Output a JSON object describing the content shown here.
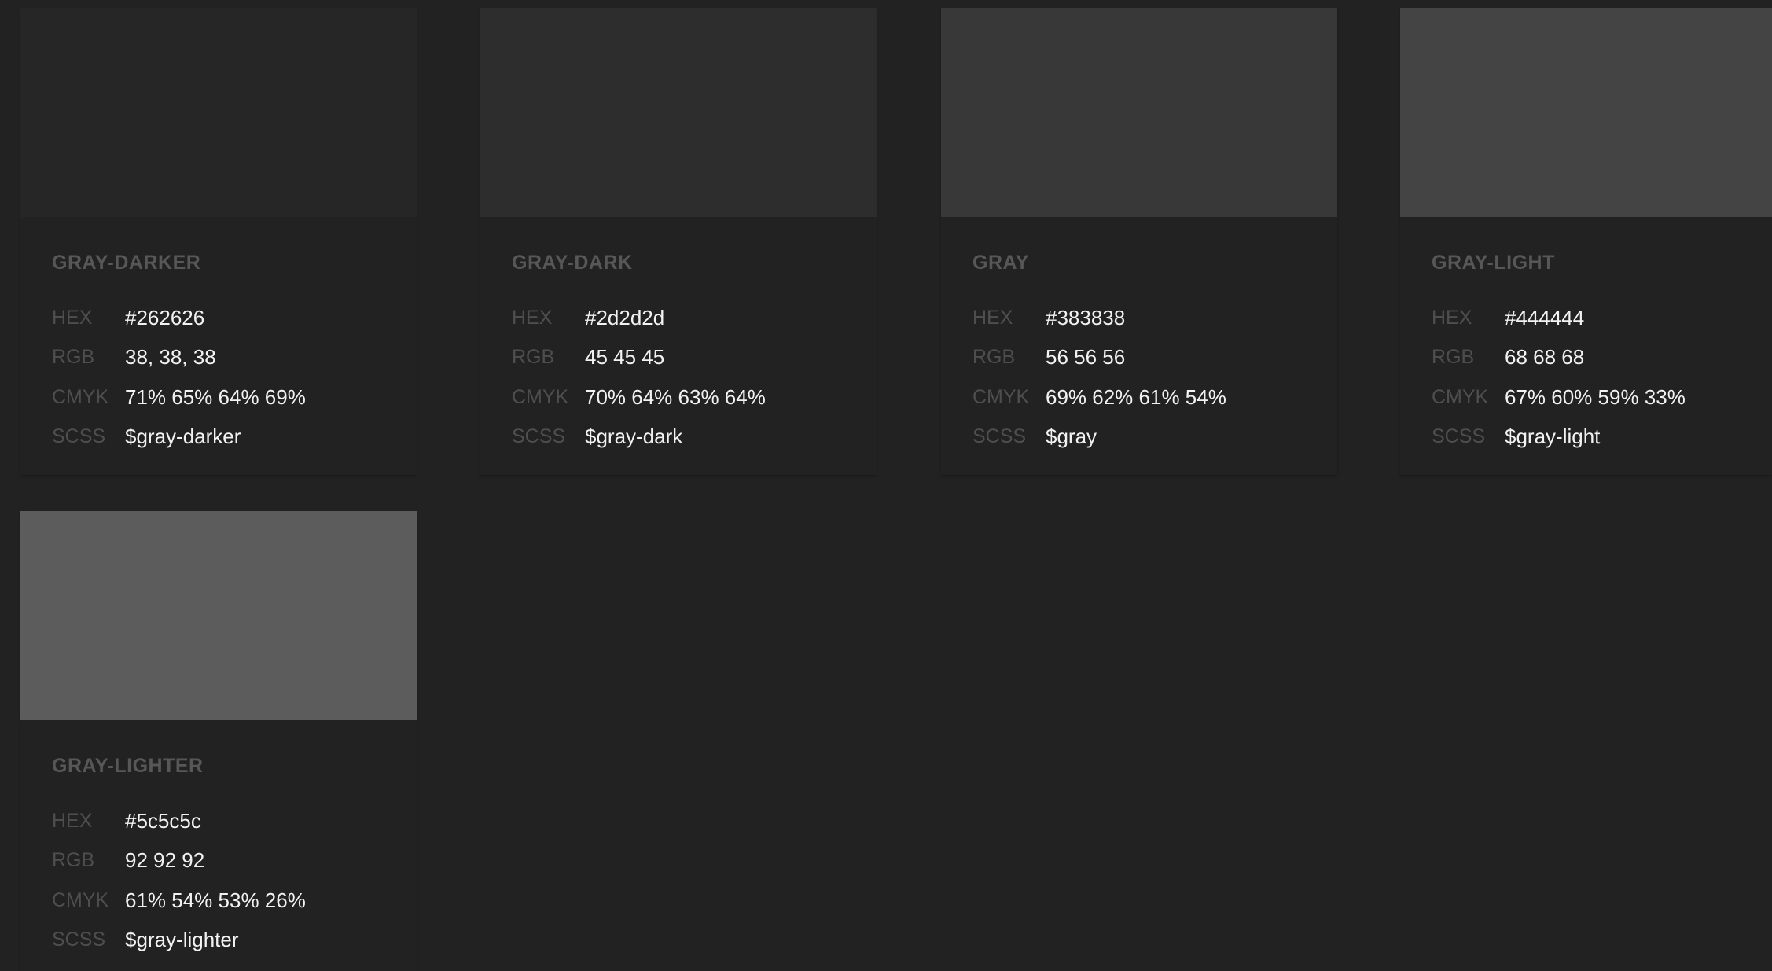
{
  "swatches": [
    {
      "name": "GRAY-DARKER",
      "color": "#262626",
      "hex_label": "HEX",
      "hex": "#262626",
      "rgb_label": "RGB",
      "rgb": "38, 38, 38",
      "cmyk_label": "CMYK",
      "cmyk": "71% 65% 64% 69%",
      "scss_label": "SCSS",
      "scss": "$gray-darker"
    },
    {
      "name": "GRAY-DARK",
      "color": "#2d2d2d",
      "hex_label": "HEX",
      "hex": "#2d2d2d",
      "rgb_label": "RGB",
      "rgb": "45 45 45",
      "cmyk_label": "CMYK",
      "cmyk": "70% 64% 63% 64%",
      "scss_label": "SCSS",
      "scss": "$gray-dark"
    },
    {
      "name": "GRAY",
      "color": "#383838",
      "hex_label": "HEX",
      "hex": "#383838",
      "rgb_label": "RGB",
      "rgb": "56 56 56",
      "cmyk_label": "CMYK",
      "cmyk": "69% 62% 61% 54%",
      "scss_label": "SCSS",
      "scss": "$gray"
    },
    {
      "name": "GRAY-LIGHT",
      "color": "#444444",
      "hex_label": "HEX",
      "hex": "#444444",
      "rgb_label": "RGB",
      "rgb": "68 68 68",
      "cmyk_label": "CMYK",
      "cmyk": "67% 60% 59% 33%",
      "scss_label": "SCSS",
      "scss": "$gray-light"
    },
    {
      "name": "GRAY-LIGHTER",
      "color": "#5c5c5c",
      "hex_label": "HEX",
      "hex": "#5c5c5c",
      "rgb_label": "RGB",
      "rgb": "92 92 92",
      "cmyk_label": "CMYK",
      "cmyk": "61% 54% 53% 26%",
      "scss_label": "SCSS",
      "scss": "$gray-lighter"
    }
  ]
}
